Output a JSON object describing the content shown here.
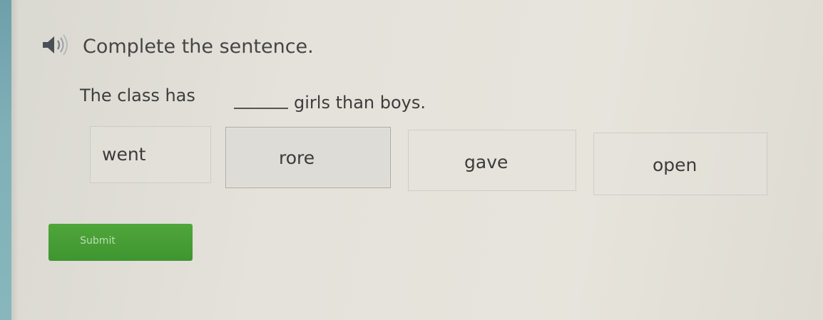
{
  "question": {
    "prompt": "Complete the sentence.",
    "sentence_before": "The class has",
    "sentence_after": "girls than boys."
  },
  "choices": [
    {
      "label": "went"
    },
    {
      "label": "rore"
    },
    {
      "label": "gave"
    },
    {
      "label": "open"
    }
  ],
  "submit_label": "Submit",
  "icons": {
    "audio": "speaker-icon"
  },
  "colors": {
    "submit_button": "#46a033",
    "left_bar": "#7fb0b8"
  }
}
